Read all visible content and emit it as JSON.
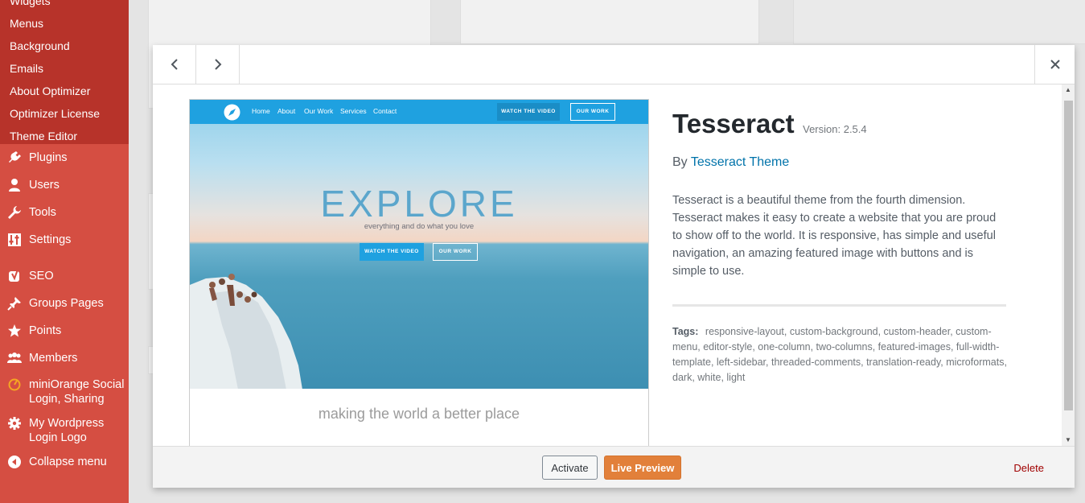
{
  "sidebar": {
    "submenu": [
      "Widgets",
      "Menus",
      "Background",
      "Emails",
      "About Optimizer",
      "Optimizer License",
      "Theme Editor"
    ],
    "menu": [
      {
        "label": "Plugins",
        "icon": "plugin-icon"
      },
      {
        "label": "Users",
        "icon": "user-icon"
      },
      {
        "label": "Tools",
        "icon": "wrench-icon"
      },
      {
        "label": "Settings",
        "icon": "settings-icon"
      },
      {
        "label": "SEO",
        "icon": "yoast-icon"
      },
      {
        "label": "Groups Pages",
        "icon": "pin-icon"
      },
      {
        "label": "Points",
        "icon": "star-icon"
      },
      {
        "label": "Members",
        "icon": "members-icon"
      },
      {
        "label": "miniOrange Social Login, Sharing",
        "icon": "miniorange-icon"
      },
      {
        "label": "My Wordpress Login Logo",
        "icon": "gear-icon"
      },
      {
        "label": "Collapse menu",
        "icon": "collapse-icon"
      }
    ]
  },
  "colors": {
    "sidebar_bg": "#d54e42",
    "submenu_bg": "#b7332a",
    "link": "#0073aa",
    "preview_button": "#e2803a",
    "delete": "#a00000"
  },
  "theme": {
    "name": "Tesseract",
    "version": "Version: 2.5.4",
    "by": "By",
    "author": "Tesseract Theme",
    "description": "Tesseract is a beautiful theme from the fourth dimension. Tesseract makes it easy to create a website that you are proud to show off to the world. It is responsive, has simple and useful navigation, an amazing featured image with buttons and is simple to use.",
    "tags_label": "Tags:",
    "tags": "responsive-layout, custom-background, custom-header, custom-menu, editor-style, one-column, two-columns, featured-images, full-width-template, left-sidebar, threaded-comments, translation-ready, microformats, dark, white, light"
  },
  "screenshot": {
    "nav_links": [
      "Home",
      "About",
      "Our Work",
      "Services",
      "Contact"
    ],
    "nav_btn_video": "WATCH THE VIDEO",
    "nav_btn_work": "OUR WORK",
    "headline": "EXPLORE",
    "subhead": "everything and do what you love",
    "hero_btn_video": "WATCH THE VIDEO",
    "hero_btn_work": "OUR WORK",
    "caption": "making the world a better place"
  },
  "footer": {
    "activate": "Activate",
    "live_preview": "Live Preview",
    "delete": "Delete"
  }
}
